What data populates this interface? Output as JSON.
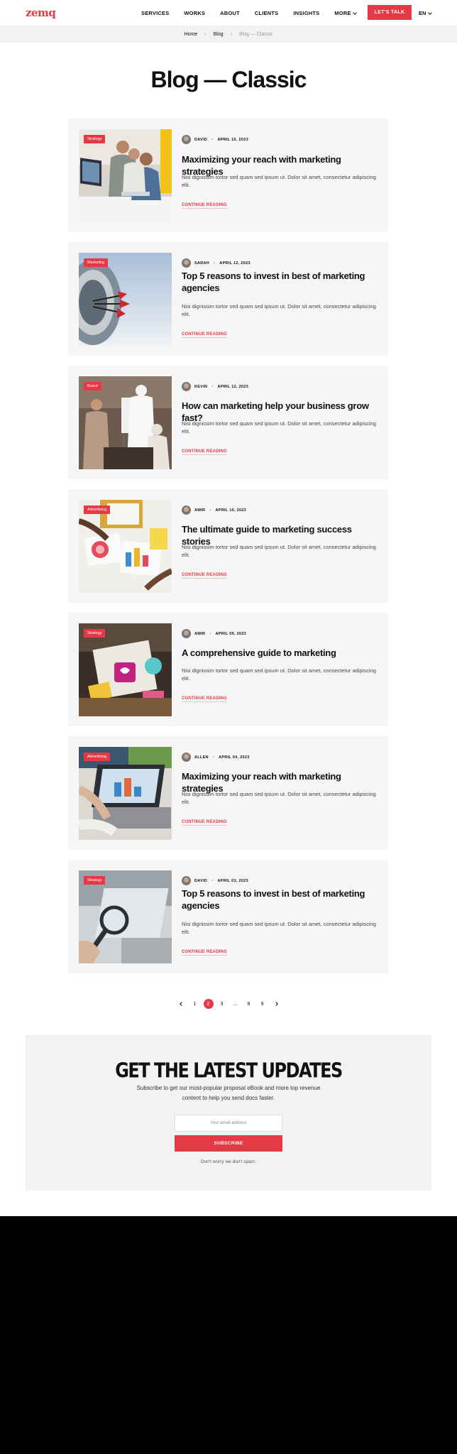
{
  "header": {
    "logo": "zemq",
    "nav": [
      "SERVICES",
      "WORKS",
      "ABOUT",
      "CLIENTS",
      "INSIGHTS",
      "MORE"
    ],
    "cta": "LET'S TALK",
    "lang": "EN"
  },
  "breadcrumb": [
    "Home",
    "Blog",
    "Blog — Classic"
  ],
  "page_title": "Blog — Classic",
  "posts": [
    {
      "category": "Strategy",
      "author": "DAVID",
      "date": "APRIL 15, 2023",
      "title": "Maximizing your reach with marketing strategies",
      "excerpt": "Nisi dignissim tortor sed quam sed ipsum ut. Dolor sit amet, consectetur adipiscing elit.",
      "link": "CONTINUE READING"
    },
    {
      "category": "Marketing",
      "author": "SARAH",
      "date": "APRIL 12, 2023",
      "title": "Top 5 reasons to invest in best of marketing agencies",
      "excerpt": "Nisi dignissim tortor sed quam sed ipsum ut. Dolor sit amet, consectetur adipiscing elit.",
      "link": "CONTINUE READING"
    },
    {
      "category": "Brand",
      "author": "KEVIN",
      "date": "APRIL 12, 2023",
      "title": "How can marketing help your business grow fast?",
      "excerpt": "Nisi dignissim tortor sed quam sed ipsum ut. Dolor sit amet, consectetur adipiscing elit.",
      "link": "CONTINUE READING"
    },
    {
      "category": "Advertising",
      "author": "AMIR",
      "date": "APRIL 10, 2023",
      "title": "The ultimate guide to marketing success stories",
      "excerpt": "Nisi dignissim tortor sed quam sed ipsum ut. Dolor sit amet, consectetur adipiscing elit.",
      "link": "CONTINUE READING"
    },
    {
      "category": "Strategy",
      "author": "AMIR",
      "date": "APRIL 09, 2023",
      "title": "A comprehensive guide to marketing",
      "excerpt": "Nisi dignissim tortor sed quam sed ipsum ut. Dolor sit amet, consectetur adipiscing elit.",
      "link": "CONTINUE READING"
    },
    {
      "category": "Advertising",
      "author": "ALLEN",
      "date": "APRIL 04, 2023",
      "title": "Maximizing your reach with marketing strategies",
      "excerpt": "Nisi dignissim tortor sed quam sed ipsum ut. Dolor sit amet, consectetur adipiscing elit.",
      "link": "CONTINUE READING"
    },
    {
      "category": "Strategy",
      "author": "DAVID",
      "date": "APRIL 03, 2023",
      "title": "Top 5 reasons to invest in best of marketing agencies",
      "excerpt": "Nisi dignissim tortor sed quam sed ipsum ut. Dolor sit amet, consectetur adipiscing elit.",
      "link": "CONTINUE READING"
    }
  ],
  "pagination": {
    "pages": [
      "1",
      "2",
      "3",
      "...",
      "8",
      "9"
    ],
    "active": "2"
  },
  "newsletter": {
    "title": "GET THE LATEST UPDATES",
    "subtitle": "Subscribe to get our most-popular proposal eBook and more top revenue content to help you send docs faster.",
    "placeholder": "Your email address",
    "button": "SUBSCRIBE",
    "note": "Don't worry we don't spam."
  },
  "colors": {
    "accent": "#e63946",
    "panel": "#f6f6f6",
    "footer": "#000000"
  }
}
